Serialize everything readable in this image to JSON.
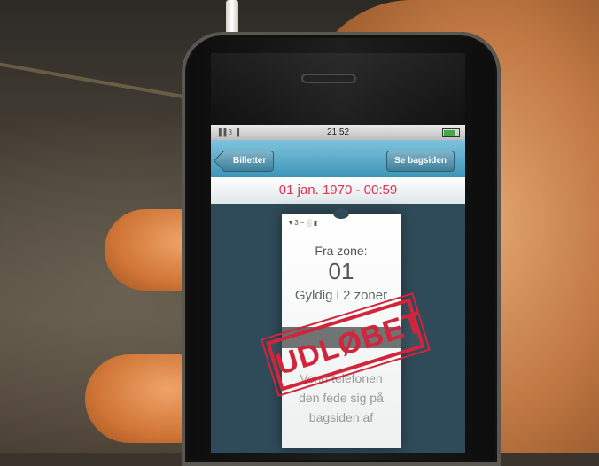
{
  "scene": {
    "description_elements": [
      "hand",
      "phone",
      "tram-interior"
    ]
  },
  "statusbar": {
    "carrier": "▐▐ 3 ▐",
    "time": "21:52"
  },
  "navbar": {
    "back_label": "Billetter",
    "right_label": "Se bagsiden"
  },
  "datebar": {
    "text": "01 jan. 1970 - 00:59"
  },
  "ticket": {
    "status": "▾ 3 − ░ ▮",
    "zone_label": "Fra zone:",
    "zone_number": "01",
    "valid_label": "Gyldig i 2 zoner",
    "back_note_lines": [
      "Vend telefonen",
      "den fede sig på",
      "bagsiden af"
    ]
  },
  "stamp": {
    "text": "UDLØBET"
  },
  "colors": {
    "accent_red": "#d0253a",
    "nav_blue": "#3d95b8"
  }
}
